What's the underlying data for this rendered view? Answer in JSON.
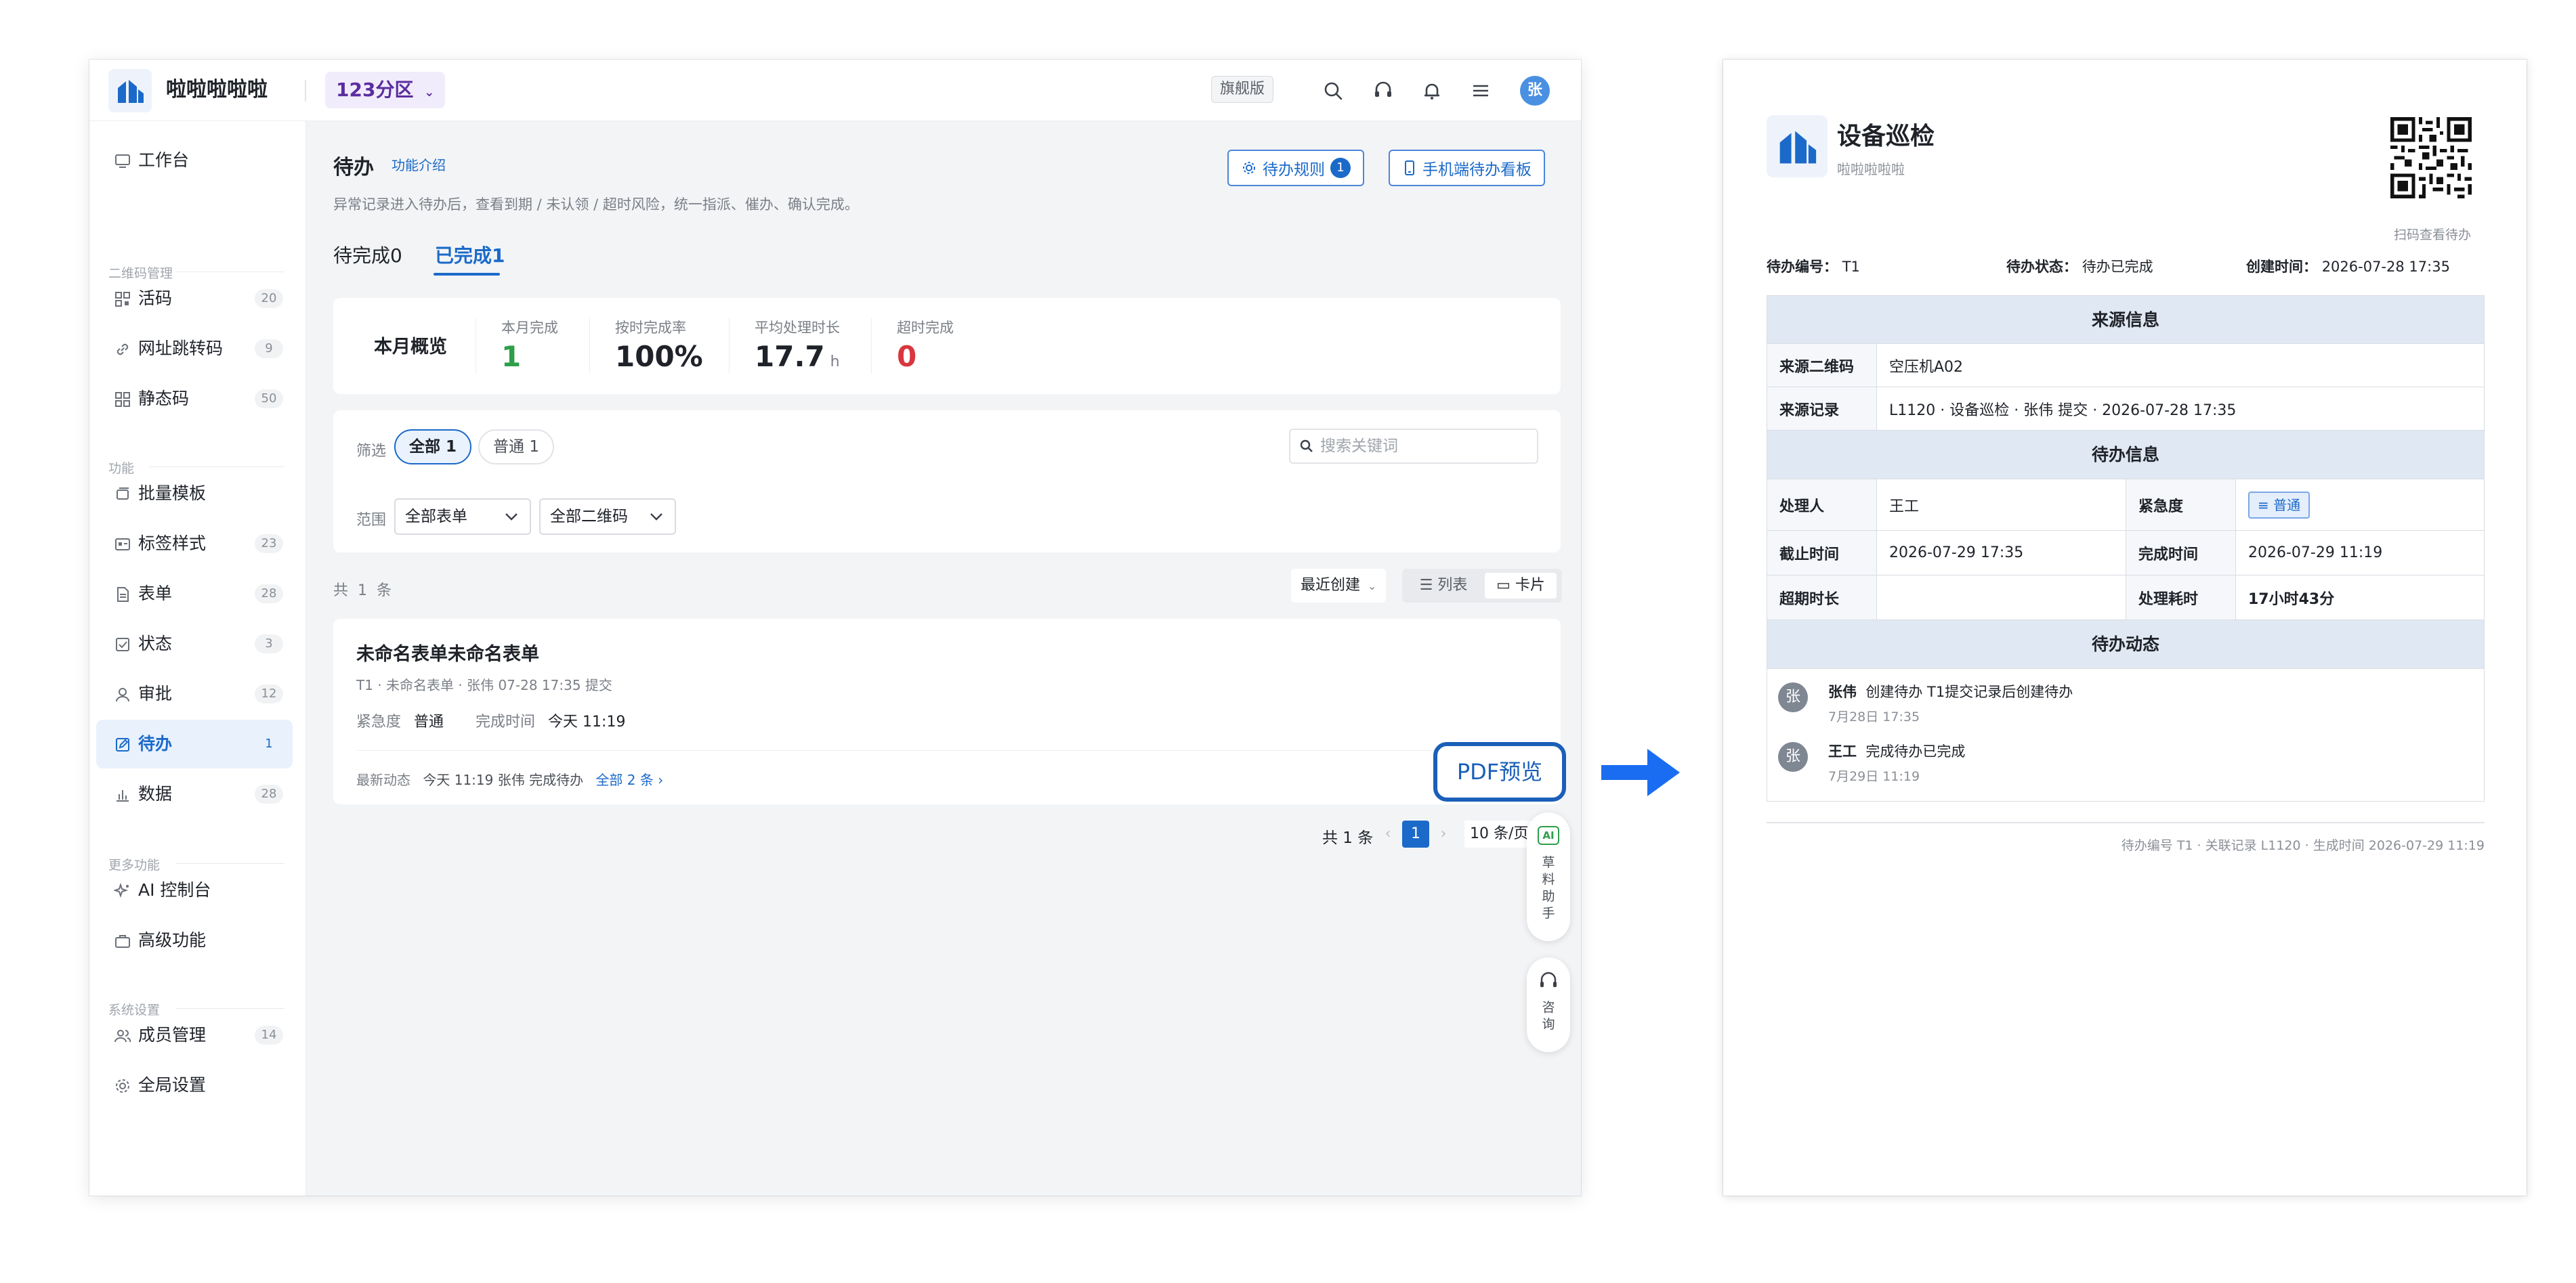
{
  "app": {
    "name": "啦啦啦啦啦",
    "workspace": "123分区",
    "edition": "旗舰版",
    "avatar": "张"
  },
  "sidebar": {
    "items": [
      {
        "label": "工作台"
      },
      {
        "label": "活码",
        "count": "20"
      },
      {
        "label": "网址跳转码",
        "count": "9"
      },
      {
        "label": "静态码",
        "count": "50"
      },
      {
        "label": "批量模板"
      },
      {
        "label": "标签样式",
        "count": "23"
      },
      {
        "label": "表单",
        "count": "28"
      },
      {
        "label": "状态",
        "count": "3"
      },
      {
        "label": "审批",
        "count": "12"
      },
      {
        "label": "待办",
        "count": "1"
      },
      {
        "label": "数据",
        "count": "28"
      },
      {
        "label": "AI 控制台"
      },
      {
        "label": "高级功能"
      },
      {
        "label": "成员管理",
        "count": "14"
      },
      {
        "label": "全局设置"
      }
    ],
    "sections": [
      "二维码管理",
      "功能",
      "更多功能",
      "系统设置"
    ]
  },
  "page": {
    "title": "待办",
    "intro_link": "功能介绍",
    "description": "异常记录进入待办后，查看到期 / 未认领 / 超时风险，统一指派、催办、确认完成。",
    "rule_button": "待办规则",
    "rule_count": "1",
    "mobile_button": "手机端待办看板",
    "tabs": [
      "待完成0",
      "已完成1"
    ]
  },
  "overview": {
    "heading": "本月概览",
    "stats": [
      {
        "label": "本月完成",
        "value": "1",
        "unit": "",
        "color": "#2e9e4a"
      },
      {
        "label": "按时完成率",
        "value": "100%",
        "unit": "",
        "color": "#1f2329"
      },
      {
        "label": "平均处理时长",
        "value": "17.7",
        "unit": "h",
        "color": "#1f2329"
      },
      {
        "label": "超时完成",
        "value": "0",
        "unit": "",
        "color": "#d9363e"
      }
    ]
  },
  "filter": {
    "label": "筛选",
    "chip_all": "全部",
    "chip_all_count": "1",
    "chip_normal": "普通",
    "chip_normal_count": "1",
    "search_placeholder": "搜索关键词",
    "scope_label": "范围",
    "select_form": "全部表单",
    "select_code": "全部二维码"
  },
  "list": {
    "total_prefix": "共",
    "total": "1",
    "total_suffix": "条",
    "sort": "最近创建",
    "view_list": "列表",
    "view_card": "卡片"
  },
  "task": {
    "title": "未命名表单未命名表单",
    "meta": "T1 · 未命名表单 · 张伟 07-28 17:35 提交",
    "urgency_label": "紧急度",
    "urgency": "普通",
    "done_label": "完成时间",
    "done": "今天 11:19",
    "activity_label": "最新动态",
    "activity": "今天 11:19 张伟 完成待办",
    "activity_link": "全部 2 条 ›"
  },
  "pdf_callout": "PDF预览",
  "pagination": {
    "summary": "共 1 条",
    "page": "1",
    "page_size": "10 条/页"
  },
  "float_tools": {
    "ai_badge": "AI",
    "assistant": [
      "草",
      "料",
      "助",
      "手"
    ],
    "consult": [
      "咨",
      "询"
    ]
  },
  "preview": {
    "title": "设备巡检",
    "subtitle": "啦啦啦啦啦",
    "qr_caption": "扫码查看待办",
    "meta": [
      {
        "label": "待办编号：",
        "value": "T1"
      },
      {
        "label": "待办状态：",
        "value": "待办已完成"
      },
      {
        "label": "创建时间：",
        "value": "2026-07-28 17:35"
      }
    ],
    "section_source": "来源信息",
    "source_code_label": "来源二维码",
    "source_code": "空压机A02",
    "source_record_label": "来源记录",
    "source_record": "L1120 · 设备巡检 · 张伟 提交 · 2026-07-28 17:35",
    "section_todo": "待办信息",
    "handler_label": "处理人",
    "handler": "王工",
    "urgency_label": "紧急度",
    "urgency": "普通",
    "deadline_label": "截止时间",
    "deadline": "2026-07-29 17:35",
    "done_label": "完成时间",
    "done": "2026-07-29 11:19",
    "overdue_label": "超期时长",
    "overdue": "",
    "duration_label": "处理耗时",
    "duration": "17小时43分",
    "section_activity": "待办动态",
    "activities": [
      {
        "avatar": "张",
        "name": "张伟",
        "text": "创建待办 T1提交记录后创建待办",
        "time": "7月28日 17:35"
      },
      {
        "avatar": "张",
        "name": "王工",
        "text": "完成待办已完成",
        "time": "7月29日 11:19"
      }
    ],
    "footer": "待办编号 T1 · 关联记录 L1120 · 生成时间 2026-07-29 11:19"
  },
  "colors": {
    "primary": "#1b6ac9",
    "arrow": "#1a6df0",
    "success": "#2e9e4a",
    "danger": "#d9363e"
  }
}
